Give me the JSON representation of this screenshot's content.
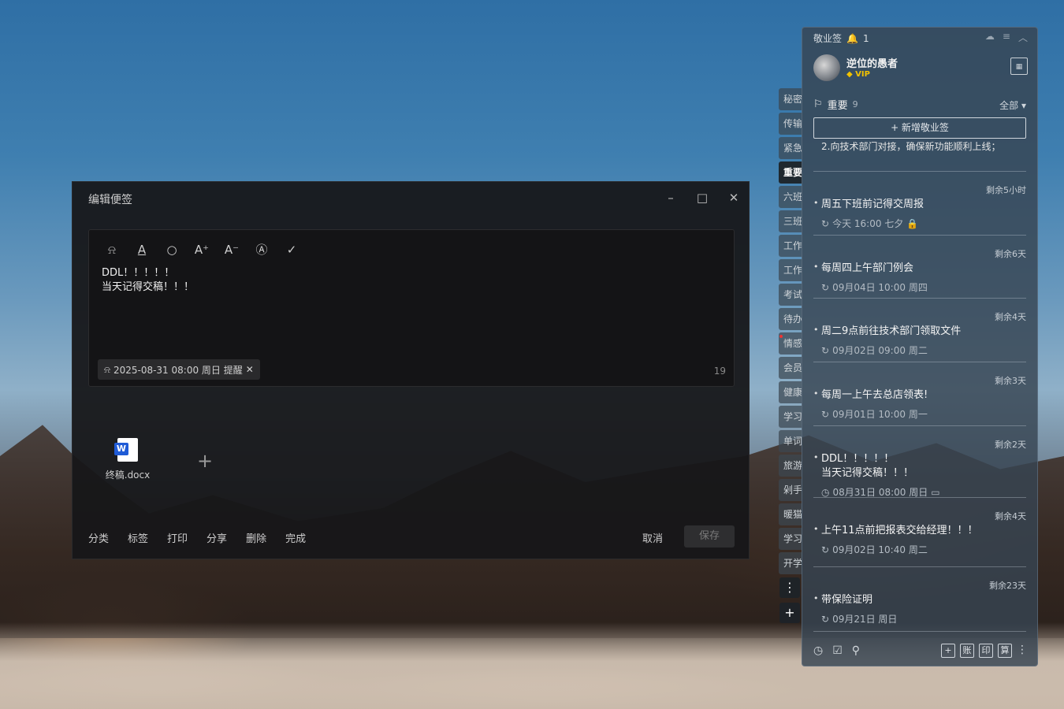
{
  "edit_window": {
    "title": "编辑便签",
    "controls": {
      "minimize": "–",
      "maximize": "□",
      "close": "✕"
    },
    "toolbar": {
      "bell": "⍾",
      "text_color": "A",
      "search": "○",
      "font_increase": "A⁺",
      "font_decrease": "A⁻",
      "format": "Ⓐ",
      "done": "✓"
    },
    "content_lines": [
      "DDL！！！！！",
      "当天记得交稿！！！"
    ],
    "reminder": {
      "icon": "⍾",
      "text": "2025-08-31 08:00 周日 提醒",
      "remove": "✕"
    },
    "char_count": "19",
    "attachment": {
      "icon_letter": "W",
      "name": "终稿.docx"
    },
    "add_attachment": "+",
    "actions": [
      "分类",
      "标签",
      "打印",
      "分享",
      "删除",
      "完成"
    ],
    "cancel": "取消",
    "save": "保存"
  },
  "category_tabs": [
    {
      "label": "秘密",
      "active": false,
      "dot": false
    },
    {
      "label": "传输",
      "active": false,
      "dot": false
    },
    {
      "label": "紧急",
      "active": false,
      "dot": false
    },
    {
      "label": "重要",
      "active": true,
      "dot": false
    },
    {
      "label": "六班",
      "active": false,
      "dot": false
    },
    {
      "label": "三班",
      "active": false,
      "dot": false
    },
    {
      "label": "工作",
      "active": false,
      "dot": false
    },
    {
      "label": "工作",
      "active": false,
      "dot": false
    },
    {
      "label": "考试",
      "active": false,
      "dot": false
    },
    {
      "label": "待办",
      "active": false,
      "dot": false
    },
    {
      "label": "情感",
      "active": false,
      "dot": true
    },
    {
      "label": "会员",
      "active": false,
      "dot": false
    },
    {
      "label": "健康",
      "active": false,
      "dot": false
    },
    {
      "label": "学习",
      "active": false,
      "dot": false
    },
    {
      "label": "单词",
      "active": false,
      "dot": false
    },
    {
      "label": "旅游",
      "active": false,
      "dot": false
    },
    {
      "label": "剁手",
      "active": false,
      "dot": false
    },
    {
      "label": "暖猫",
      "active": false,
      "dot": false
    },
    {
      "label": "学习",
      "active": false,
      "dot": false
    },
    {
      "label": "开学",
      "active": false,
      "dot": false
    }
  ],
  "category_controls": {
    "more": "⋮",
    "add": "+"
  },
  "panel": {
    "app_name": "敬业签",
    "notification_icon": "🔔",
    "notification_count": "1",
    "top_icons": {
      "cloud": "☁",
      "menu": "≡",
      "collapse": "︿"
    },
    "user": {
      "name": "逆位的愚者",
      "badge": "VIP"
    },
    "calendar_icon": "▦",
    "section": {
      "bookmark": "⚐",
      "title": "重要",
      "count": "9"
    },
    "filter": "全部 ▾",
    "new_note": "+ 新增敬业签",
    "partial_note": "2.向技术部门对接，确保新功能顺利上线；",
    "notes": [
      {
        "remain": "剩余5小时",
        "lines": [
          "周五下班前记得交周报"
        ],
        "time": "今天 16:00 七夕",
        "time_icon": "↻",
        "extra_icon": "🔒"
      },
      {
        "remain": "剩余6天",
        "lines": [
          "每周四上午部门例会"
        ],
        "time": "09月04日 10:00 周四",
        "time_icon": "↻",
        "extra_icon": ""
      },
      {
        "remain": "剩余4天",
        "lines": [
          "周二9点前往技术部门领取文件"
        ],
        "time": "09月02日 09:00 周二",
        "time_icon": "↻",
        "extra_icon": ""
      },
      {
        "remain": "剩余3天",
        "lines": [
          "每周一上午去总店领表!"
        ],
        "time": "09月01日 10:00 周一",
        "time_icon": "↻",
        "extra_icon": ""
      },
      {
        "remain": "剩余2天",
        "lines": [
          "DDL！！！！！",
          "当天记得交稿！！！"
        ],
        "time": "08月31日 08:00 周日",
        "time_icon": "◷",
        "extra_icon": "▭"
      },
      {
        "remain": "剩余4天",
        "lines": [
          "上午11点前把报表交给经理！！！"
        ],
        "time": "09月02日 10:40 周二",
        "time_icon": "↻",
        "extra_icon": ""
      },
      {
        "remain": "剩余23天",
        "lines": [
          "带保险证明"
        ],
        "time": "09月21日 周日",
        "time_icon": "↻",
        "extra_icon": ""
      }
    ],
    "bottom_left_icons": [
      "◷",
      "☑",
      "⚲"
    ],
    "bottom_right_boxes": [
      "+",
      "账",
      "印",
      "算"
    ],
    "bottom_more": "⋮"
  }
}
